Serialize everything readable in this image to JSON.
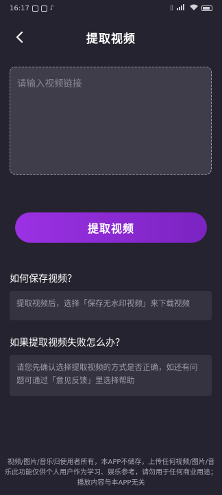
{
  "status_bar": {
    "time": "16:17"
  },
  "header": {
    "title": "提取视频"
  },
  "input": {
    "placeholder": "请输入视频链接",
    "value": ""
  },
  "extract_button": {
    "label": "提取视频"
  },
  "faq": [
    {
      "question": "如何保存视频？",
      "answer": "提取视频后，选择「保存无水印视频」来下载视频"
    },
    {
      "question": "如果提取视频失败怎么办？",
      "answer": "请您先确认选择提取视频的方式是否正确，如还有问题可通过「意见反馈」里选择帮助"
    }
  ],
  "footer": {
    "text": "视频/图片/音乐归使用者所有，本APP不储存，上传任何视频/图片/音乐此功能仅供个人用户作为学习、娱乐参考，请勿用于任何商业用途；播放内容与本APP无关"
  },
  "colors": {
    "background": "#25232f",
    "accent_start": "#9b31e3",
    "accent_end": "#7b23c2",
    "card": "#35333f"
  }
}
